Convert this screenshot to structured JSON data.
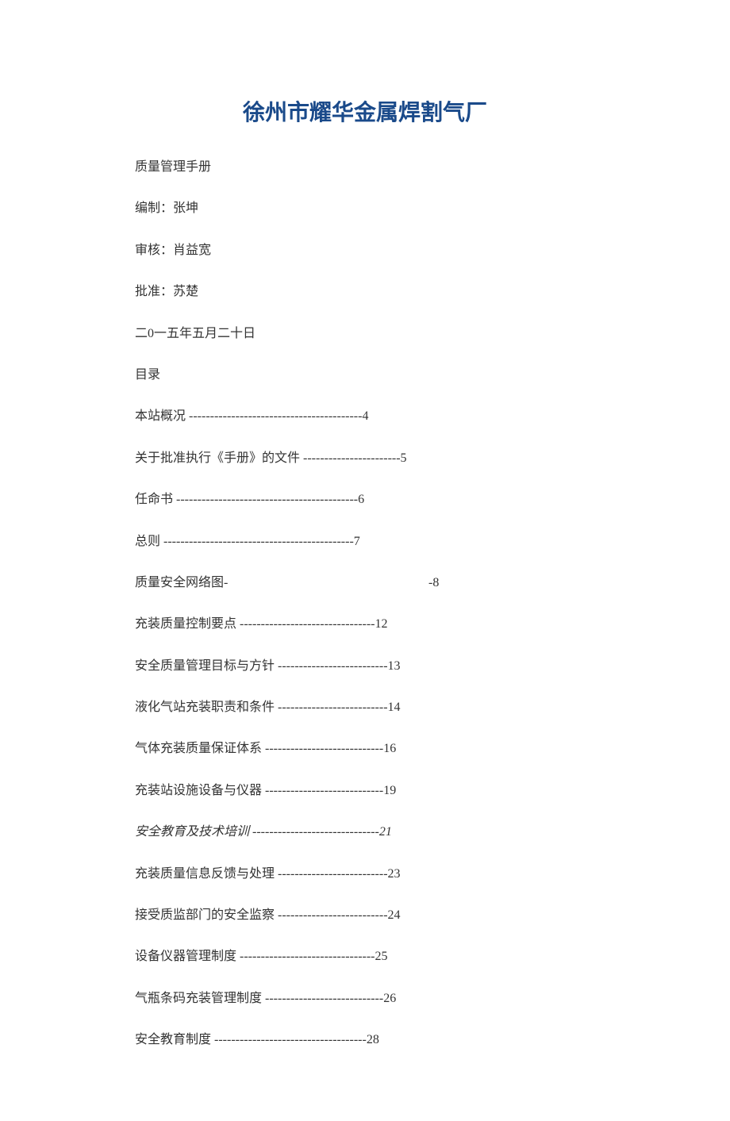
{
  "title": "徐州市耀华金属焊割气厂",
  "lines": {
    "manual": "质量管理手册",
    "compiled": "编制：张坤",
    "reviewed": "审核：肖益宽",
    "approved": "批准：苏楚",
    "date": "二0一五年五月二十日",
    "toc_heading": "目录"
  },
  "toc": {
    "e1": "本站概况 -----------------------------------------4",
    "e2": "关于批准执行《手册》的文件 -----------------------5",
    "e3": "任命书 -------------------------------------------6",
    "e4": "总则 ---------------------------------------------7",
    "e5_label": "质量安全网络图-",
    "e5_page": "-8",
    "e6": "充装质量控制要点 --------------------------------12",
    "e7": "安全质量管理目标与方针 --------------------------13",
    "e8": "液化气站充装职责和条件 --------------------------14",
    "e9": "气体充装质量保证体系 ----------------------------16",
    "e10": "充装站设施设备与仪器 ----------------------------19",
    "e11": "安全教育及技术培训 ------------------------------21",
    "e12": "充装质量信息反馈与处理 --------------------------23",
    "e13": "接受质监部门的安全监察 --------------------------24",
    "e14": "设备仪器管理制度 --------------------------------25",
    "e15": "气瓶条码充装管理制度 ----------------------------26",
    "e16": "安全教育制度 ------------------------------------28"
  }
}
